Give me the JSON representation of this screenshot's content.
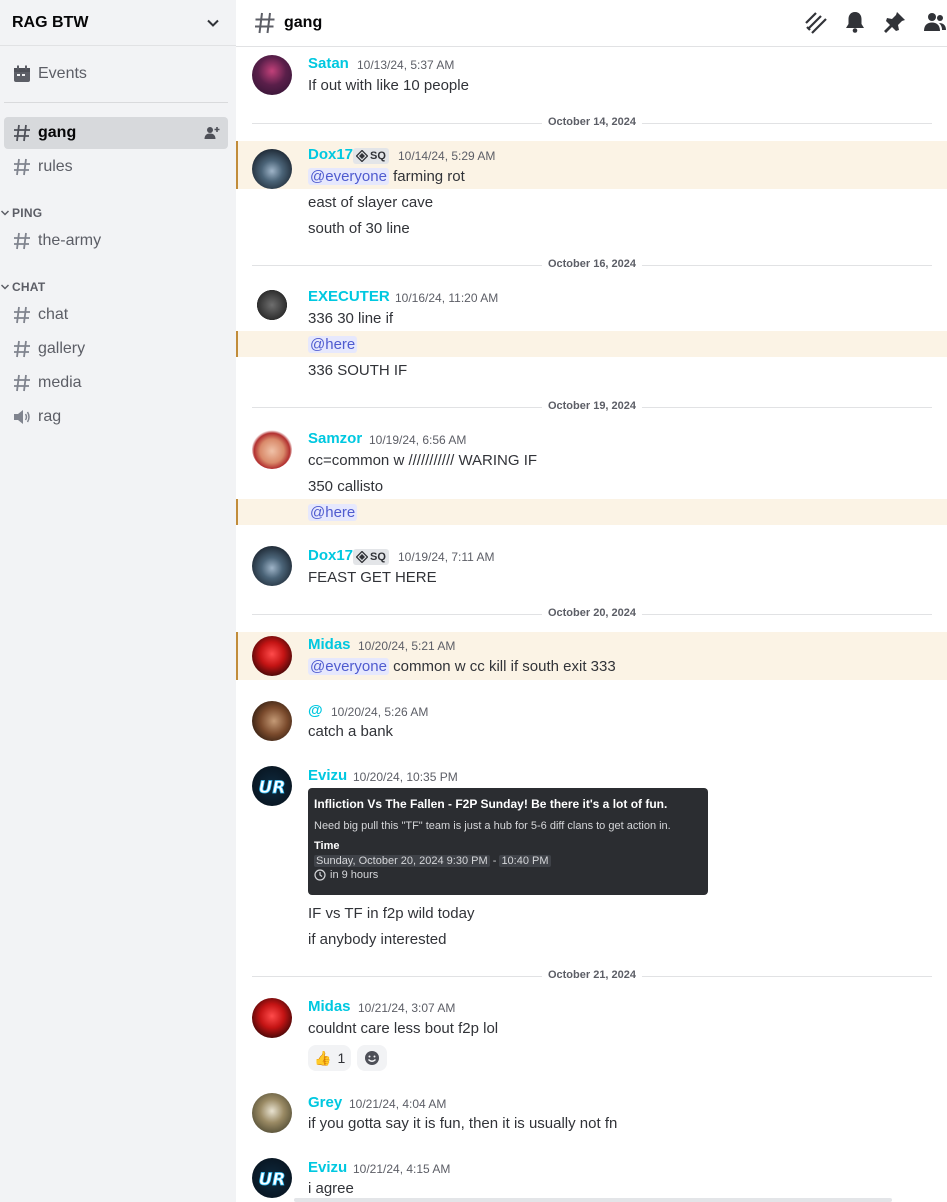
{
  "server": {
    "name": "RAG BTW"
  },
  "sidebar": {
    "events_label": "Events",
    "channels_top": [
      {
        "name": "gang",
        "active": true
      },
      {
        "name": "rules"
      }
    ],
    "categories": [
      {
        "label": "PING",
        "channels": [
          {
            "name": "the-army"
          }
        ]
      },
      {
        "label": "CHAT",
        "channels": [
          {
            "name": "chat"
          },
          {
            "name": "gallery"
          },
          {
            "name": "media"
          },
          {
            "name": "rag",
            "voice": true
          }
        ]
      }
    ]
  },
  "topbar": {
    "channel_name": "gang",
    "icons": [
      "threads-icon",
      "bell-icon",
      "pin-icon",
      "members-icon"
    ]
  },
  "colors": {
    "username": "#00c8e0",
    "mention_bg": "#e6e8fd",
    "highlight_bg": "#fbf3e5",
    "highlight_bar": "#c18c3a"
  },
  "messages": {
    "m1": {
      "user": "Satan",
      "time": "10/13/24, 5:37 AM",
      "lines": [
        "If out with like 10 people"
      ]
    },
    "sep1": "October 14, 2024",
    "m2": {
      "user": "Dox17",
      "tag": "SQ",
      "time": "10/14/24, 5:29 AM",
      "mention": "@everyone",
      "lines": [
        "farming rot",
        "east of slayer cave",
        "south of 30 line"
      ]
    },
    "sep2": "October 16, 2024",
    "m3": {
      "user": "EXECUTER",
      "time": "10/16/24, 11:20 AM",
      "mention": "@here",
      "lines": [
        "336 30 line if",
        "336 SOUTH IF"
      ]
    },
    "sep3": "October 19, 2024",
    "m4": {
      "user": "Samzor",
      "time": "10/19/24, 6:56 AM",
      "mention": "@here",
      "lines": [
        "cc=common w /////////// WARING IF",
        "350 callisto"
      ]
    },
    "m5": {
      "user": "Dox17",
      "tag": "SQ",
      "time": "10/19/24, 7:11 AM",
      "lines": [
        "FEAST GET HERE"
      ]
    },
    "sep4": "October 20, 2024",
    "m6": {
      "user": "Midas",
      "time": "10/20/24, 5:21 AM",
      "mention": "@everyone",
      "lines": [
        "common w cc kill if south exit 333"
      ]
    },
    "m7": {
      "user": "@",
      "time": "10/20/24, 5:26 AM",
      "lines": [
        "catch a bank"
      ]
    },
    "m8": {
      "user": "Evizu",
      "time": "10/20/24, 10:35 PM",
      "embed": {
        "title": "Infliction Vs The Fallen - F2P Sunday! Be there it's a lot of fun.",
        "desc": "Need big pull this \"TF\" team is just a hub for 5-6 diff clans to get action in.",
        "label": "Time",
        "start": "Sunday, October 20, 2024 9:30 PM",
        "dash": "-",
        "end": "10:40 PM",
        "relative": "in 9 hours"
      },
      "lines": [
        "IF vs TF in f2p wild today",
        "if anybody interested"
      ]
    },
    "sep5": "October 21, 2024",
    "m9": {
      "user": "Midas",
      "time": "10/21/24, 3:07 AM",
      "lines": [
        "couldnt care less bout f2p lol"
      ],
      "reaction": {
        "emoji": "👍",
        "count": "1"
      }
    },
    "m10": {
      "user": "Grey",
      "time": "10/21/24, 4:04 AM",
      "lines": [
        "if you gotta say it is fun, then it is usually not fn"
      ]
    },
    "m11": {
      "user": "Evizu",
      "time": "10/21/24, 4:15 AM",
      "lines": [
        "i agree"
      ]
    }
  }
}
